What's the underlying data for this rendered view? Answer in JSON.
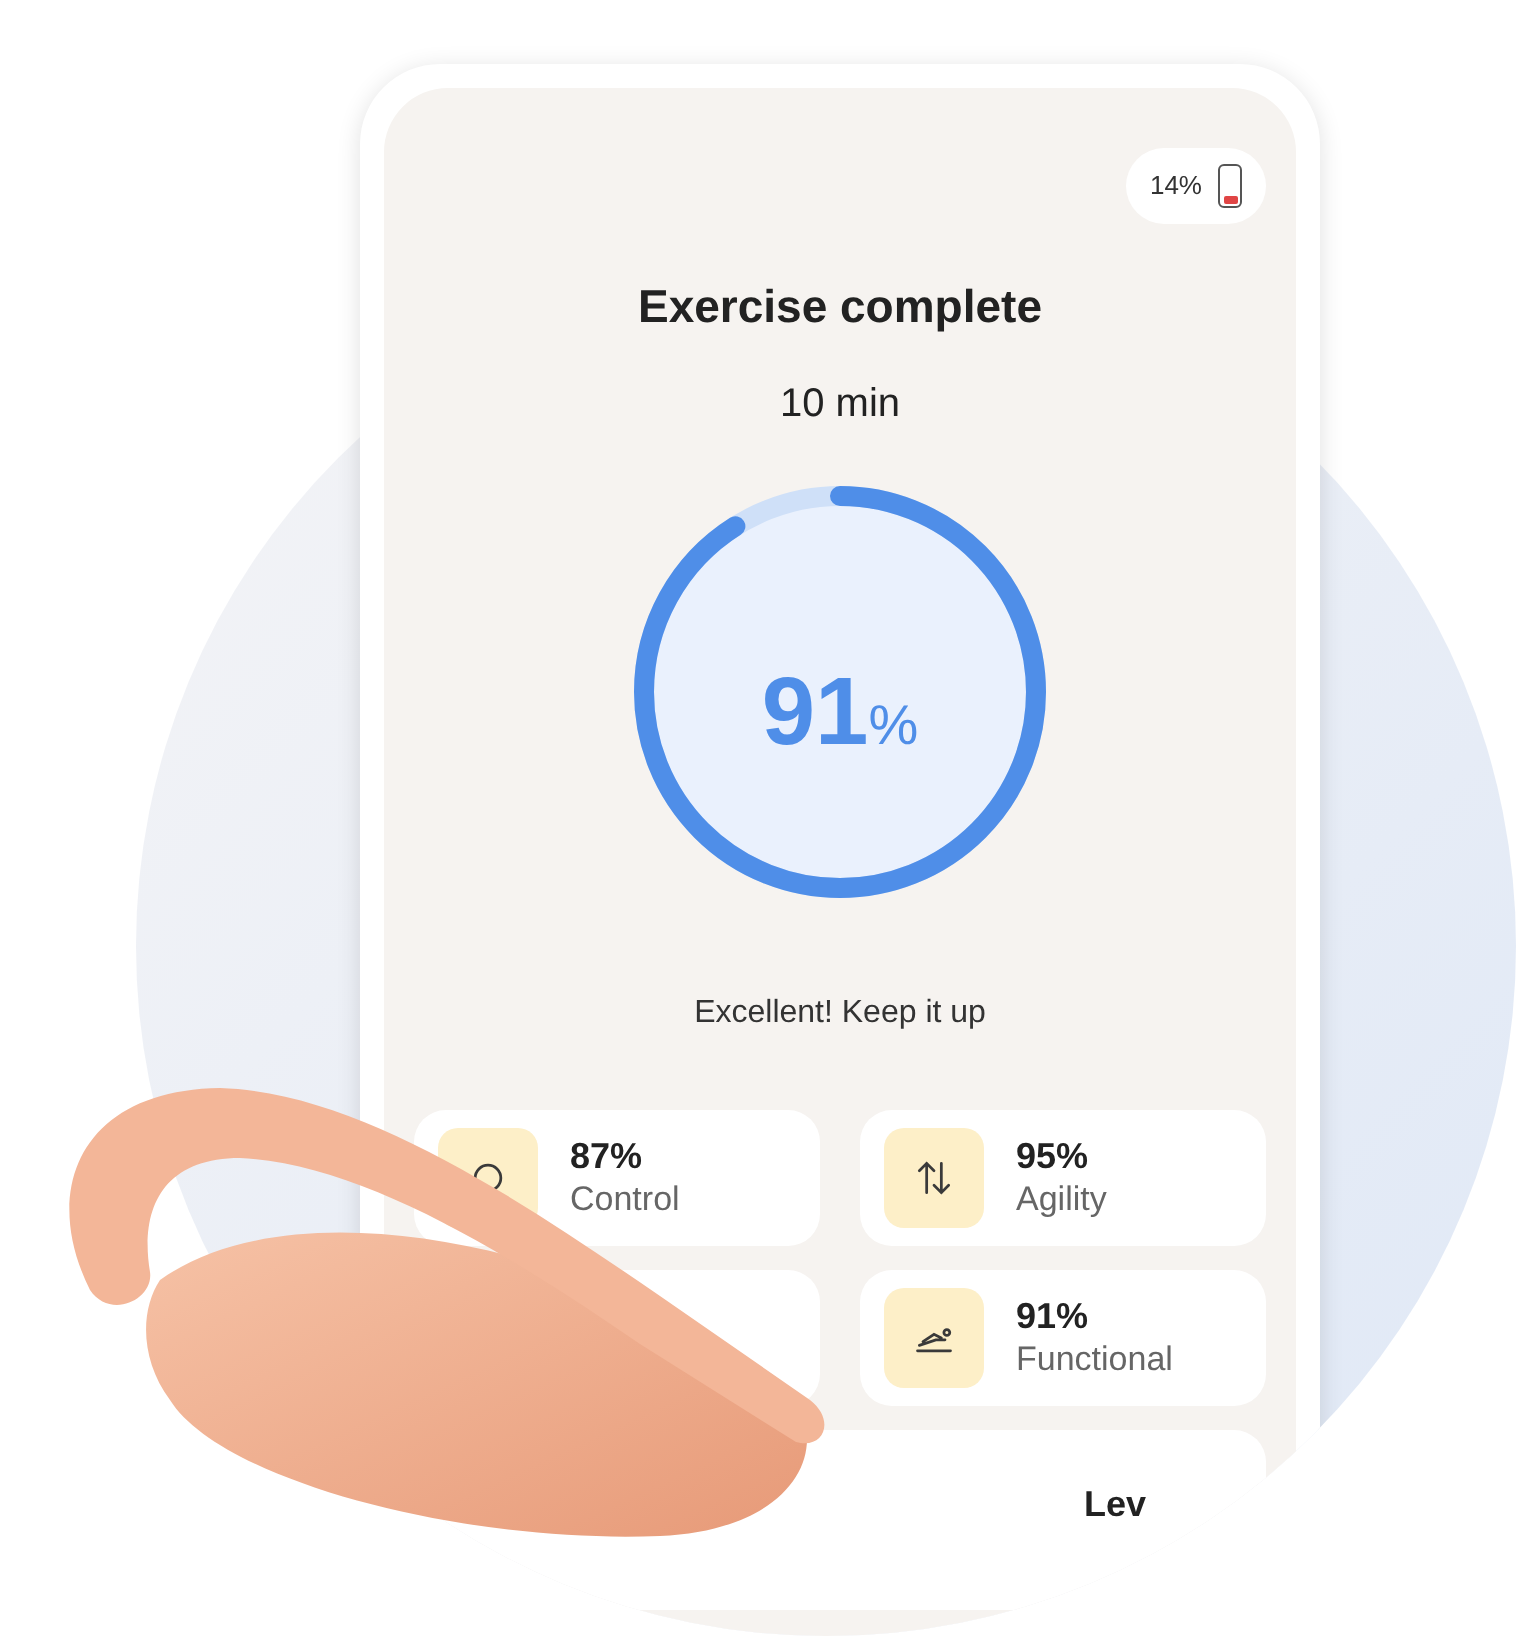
{
  "status": {
    "battery_text": "14%",
    "level": 0.14
  },
  "title": "Exercise complete",
  "duration": "10 min",
  "score": {
    "value": "91",
    "unit": "%",
    "level": 0.91
  },
  "message": "Excellent! Keep it up",
  "cards": [
    {
      "kind": "control",
      "value": "87%",
      "label": "Control"
    },
    {
      "kind": "agility",
      "value": "95%",
      "label": "Agility"
    },
    {
      "kind": "covered"
    },
    {
      "kind": "functional",
      "value": "91%",
      "label": "Functional"
    }
  ],
  "bottom_card": {
    "label": "Lev"
  }
}
